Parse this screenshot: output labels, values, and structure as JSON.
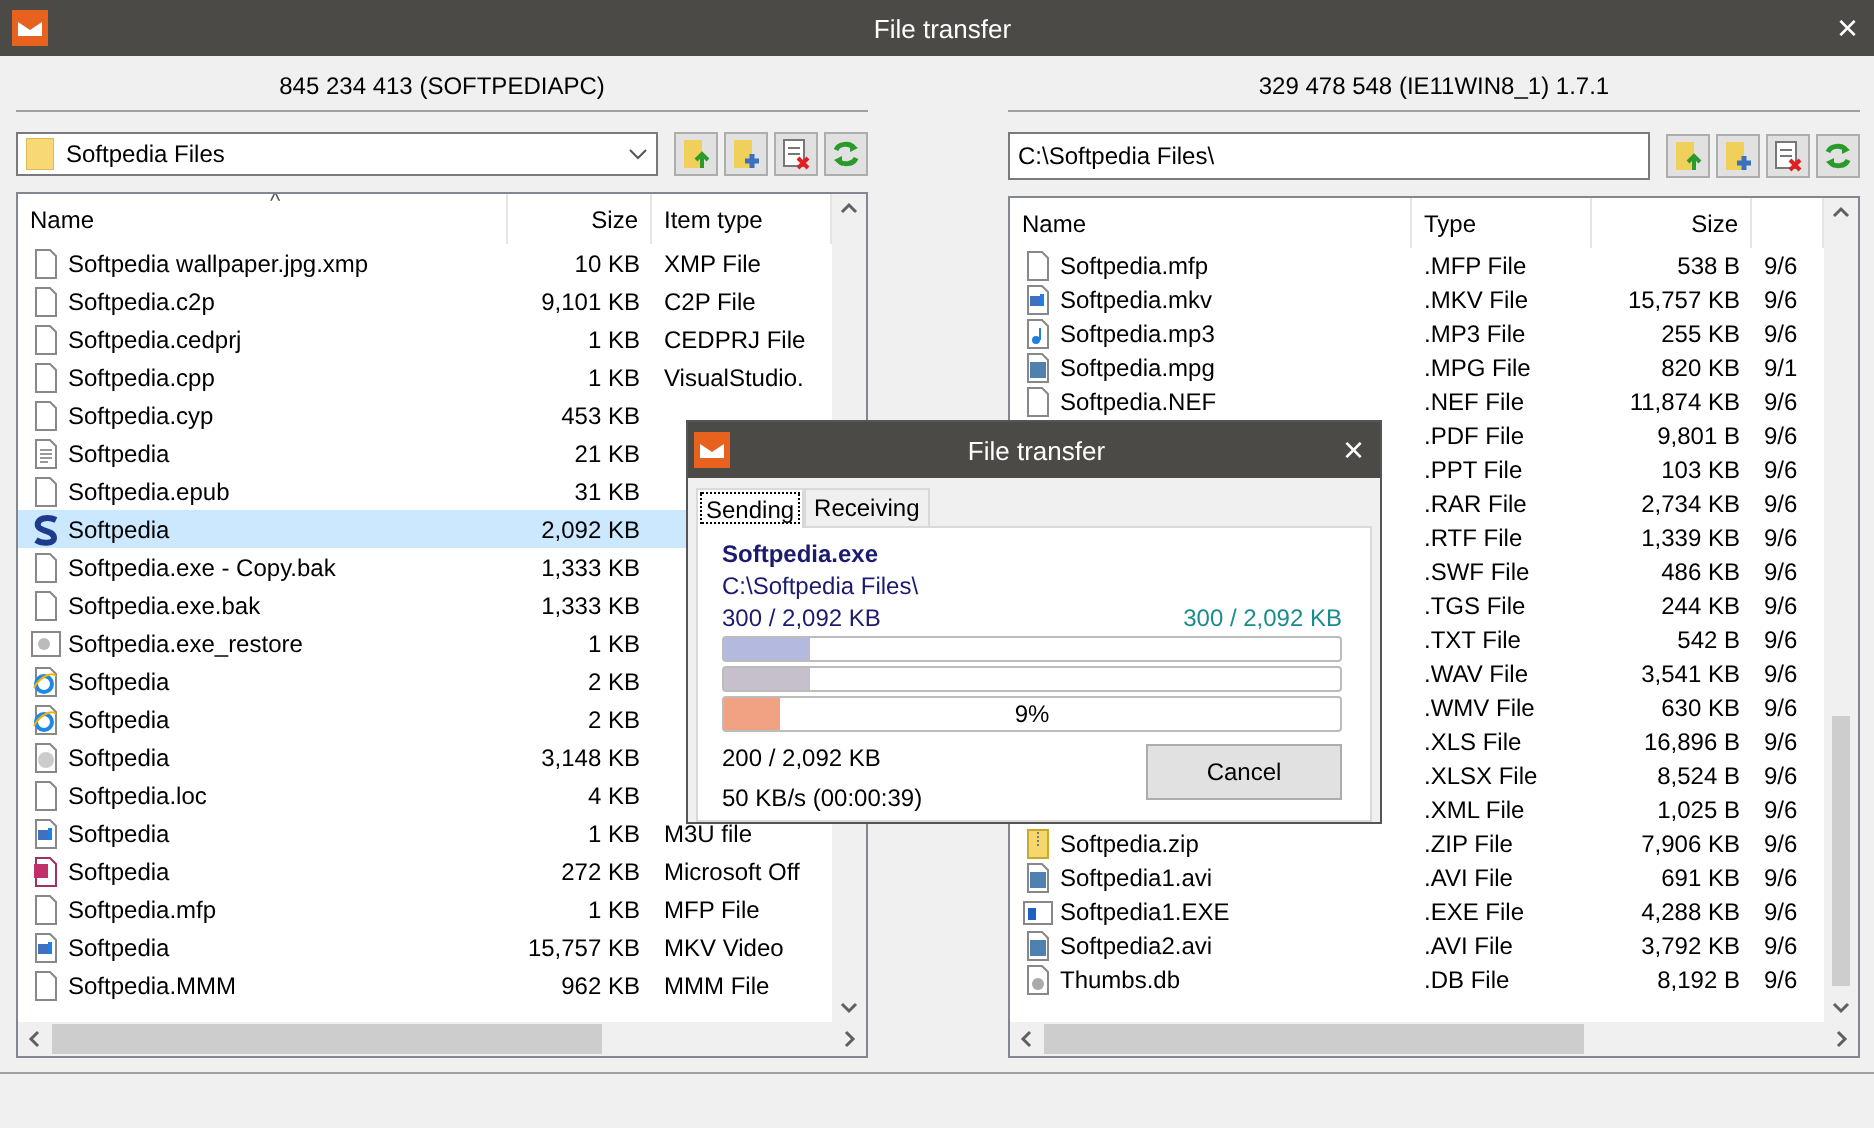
{
  "window": {
    "title": "File transfer",
    "close": "×"
  },
  "left": {
    "header": "845 234 413 (SOFTPEDIAPC)",
    "folder": "Softpedia Files",
    "sort_caret": "^",
    "columns": [
      "Name",
      "Size",
      "Item type"
    ],
    "rows": [
      {
        "kind": "blank",
        "name": "Softpedia wallpaper.jpg.xmp",
        "size": "10 KB",
        "type": "XMP File",
        "selected": false
      },
      {
        "kind": "blank",
        "name": "Softpedia.c2p",
        "size": "9,101 KB",
        "type": "C2P File",
        "selected": false
      },
      {
        "kind": "blank",
        "name": "Softpedia.cedprj",
        "size": "1 KB",
        "type": "CEDPRJ File",
        "selected": false
      },
      {
        "kind": "blank",
        "name": "Softpedia.cpp",
        "size": "1 KB",
        "type": "VisualStudio.",
        "selected": false
      },
      {
        "kind": "blank",
        "name": "Softpedia.cyp",
        "size": "453 KB",
        "selected": false
      },
      {
        "kind": "text",
        "name": "Softpedia",
        "size": "21 KB",
        "selected": false
      },
      {
        "kind": "blank",
        "name": "Softpedia.epub",
        "size": "31 KB",
        "selected": false
      },
      {
        "kind": "s",
        "name": "Softpedia",
        "size": "2,092 KB",
        "selected": true
      },
      {
        "kind": "blank",
        "name": "Softpedia.exe - Copy.bak",
        "size": "1,333 KB",
        "selected": false
      },
      {
        "kind": "blank",
        "name": "Softpedia.exe.bak",
        "size": "1,333 KB",
        "selected": false
      },
      {
        "kind": "gear",
        "name": "Softpedia.exe_restore",
        "size": "1 KB",
        "selected": false
      },
      {
        "kind": "ie",
        "name": "Softpedia",
        "size": "2 KB",
        "selected": false
      },
      {
        "kind": "ie",
        "name": "Softpedia",
        "size": "2 KB",
        "selected": false
      },
      {
        "kind": "disc",
        "name": "Softpedia",
        "size": "3,148 KB",
        "selected": false
      },
      {
        "kind": "blank",
        "name": "Softpedia.loc",
        "size": "4 KB",
        "selected": false
      },
      {
        "kind": "media",
        "name": "Softpedia",
        "size": "1 KB",
        "type": "M3U file",
        "selected": false
      },
      {
        "kind": "ppt",
        "name": "Softpedia",
        "size": "272 KB",
        "type": "Microsoft Off",
        "selected": false
      },
      {
        "kind": "blank",
        "name": "Softpedia.mfp",
        "size": "1 KB",
        "type": "MFP File",
        "selected": false
      },
      {
        "kind": "media",
        "name": "Softpedia",
        "size": "15,757 KB",
        "type": "MKV Video",
        "selected": false
      },
      {
        "kind": "blank",
        "name": "Softpedia.MMM",
        "size": "962 KB",
        "type": "MMM File",
        "selected": false
      }
    ]
  },
  "right": {
    "header": "329 478 548 (IE11WIN8_1) 1.7.1",
    "path": "C:\\Softpedia Files\\",
    "columns": [
      "Name",
      "Type",
      "Size"
    ],
    "rows": [
      {
        "kind": "blank",
        "name": "Softpedia.mfp",
        "type": ".MFP File",
        "size": "538 B",
        "date": "9/6",
        "selected": false
      },
      {
        "kind": "media",
        "name": "Softpedia.mkv",
        "type": ".MKV File",
        "size": "15,757 KB",
        "date": "9/6",
        "selected": false
      },
      {
        "kind": "music",
        "name": "Softpedia.mp3",
        "type": ".MP3 File",
        "size": "255 KB",
        "date": "9/6",
        "selected": false
      },
      {
        "kind": "film",
        "name": "Softpedia.mpg",
        "type": ".MPG File",
        "size": "820 KB",
        "date": "9/1",
        "selected": false
      },
      {
        "kind": "blank",
        "name": "Softpedia.NEF",
        "type": ".NEF File",
        "size": "11,874 KB",
        "date": "9/6",
        "selected": false
      },
      {
        "type": ".PDF File",
        "size": "9,801 B",
        "date": "9/6",
        "selected": false
      },
      {
        "type": ".PPT File",
        "size": "103 KB",
        "date": "9/6",
        "selected": false
      },
      {
        "type": ".RAR File",
        "size": "2,734 KB",
        "date": "9/6",
        "selected": false
      },
      {
        "type": ".RTF File",
        "size": "1,339 KB",
        "date": "9/6",
        "selected": false
      },
      {
        "type": ".SWF File",
        "size": "486 KB",
        "date": "9/6",
        "selected": false
      },
      {
        "type": ".TGS File",
        "size": "244 KB",
        "date": "9/6",
        "selected": false
      },
      {
        "type": ".TXT File",
        "size": "542 B",
        "date": "9/6",
        "selected": false
      },
      {
        "type": ".WAV File",
        "size": "3,541 KB",
        "date": "9/6",
        "selected": false
      },
      {
        "type": ".WMV File",
        "size": "630 KB",
        "date": "9/6",
        "selected": false
      },
      {
        "type": ".XLS File",
        "size": "16,896 B",
        "date": "9/6",
        "selected": false
      },
      {
        "type": ".XLSX File",
        "size": "8,524 B",
        "date": "9/6",
        "selected": false
      },
      {
        "type": ".XML File",
        "size": "1,025 B",
        "date": "9/6",
        "selected": false
      },
      {
        "kind": "zip",
        "name": "Softpedia.zip",
        "type": ".ZIP File",
        "size": "7,906 KB",
        "date": "9/6",
        "selected": false
      },
      {
        "kind": "film",
        "name": "Softpedia1.avi",
        "type": ".AVI File",
        "size": "691 KB",
        "date": "9/6",
        "selected": false
      },
      {
        "kind": "exe",
        "name": "Softpedia1.EXE",
        "type": ".EXE File",
        "size": "4,288 KB",
        "date": "9/6",
        "selected": false
      },
      {
        "kind": "film",
        "name": "Softpedia2.avi",
        "type": ".AVI File",
        "size": "3,792 KB",
        "date": "9/6",
        "selected": false
      },
      {
        "kind": "db",
        "name": "Thumbs.db",
        "type": ".DB File",
        "size": "8,192 B",
        "date": "9/6",
        "selected": false
      }
    ]
  },
  "dialog": {
    "title": "File transfer",
    "close": "×",
    "tabs": [
      {
        "label": "Sending",
        "selected": true
      },
      {
        "label": "Receiving",
        "selected": false
      }
    ],
    "file_name": "Softpedia.exe",
    "path": "C:\\Softpedia Files\\",
    "sent": "300 / 2,092 KB",
    "received": "300 / 2,092 KB",
    "bars": [
      {
        "level": 0.14,
        "color": "#b4b9df"
      },
      {
        "level": 0.14,
        "color": "#c5c0cc"
      },
      {
        "level": 0.09,
        "color": "#f0a283",
        "percent": "9%"
      }
    ],
    "done": "200 / 2,092 KB",
    "speed": "50 KB/s (00:00:39)",
    "button": "Cancel"
  }
}
